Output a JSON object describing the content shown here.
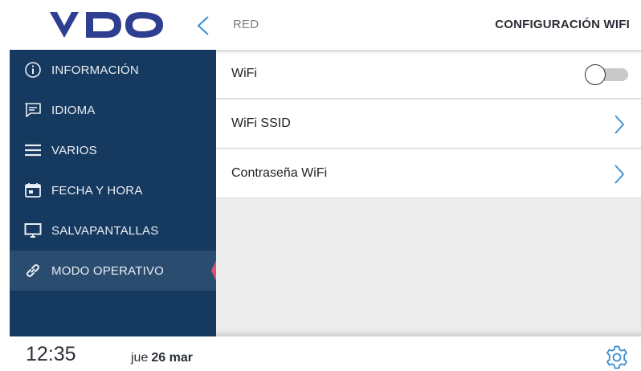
{
  "header": {
    "logo_text": "VDO",
    "breadcrumb": "RED",
    "title": "CONFIGURACIÓN WIFI"
  },
  "sidebar": {
    "items": [
      {
        "label": "INFORMACIÓN",
        "icon": "info-icon"
      },
      {
        "label": "IDIOMA",
        "icon": "chat-icon"
      },
      {
        "label": "VARIOS",
        "icon": "menu-icon"
      },
      {
        "label": "FECHA Y HORA",
        "icon": "calendar-icon"
      },
      {
        "label": "SALVAPANTALLAS",
        "icon": "monitor-icon"
      },
      {
        "label": "MODO OPERATIVO",
        "icon": "link-icon",
        "active": true
      }
    ]
  },
  "settings_list": [
    {
      "label": "WiFi",
      "control": "toggle",
      "value": "off"
    },
    {
      "label": "WiFi SSID",
      "control": "chevron-right-icon"
    },
    {
      "label": "Contraseña WiFi",
      "control": "chevron-right-icon"
    }
  ],
  "footer": {
    "time": "12:35",
    "weekday": "jue",
    "day_month": "26 mar",
    "settings_icon": "gear-icon"
  },
  "colors": {
    "brand_blue": "#2e3e90",
    "sidebar_bg": "#163a5f",
    "active_item_bg": "#2a4c6f",
    "active_marker": "#e0506a",
    "chevron_blue": "#3b8fd1"
  }
}
